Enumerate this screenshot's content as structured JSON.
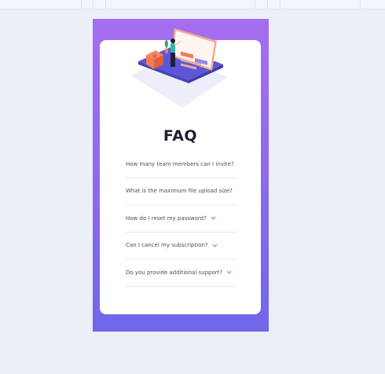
{
  "page": {
    "title": "FAQ"
  },
  "faq": {
    "items": [
      {
        "question": "How many team members can I invite?"
      },
      {
        "question": "What is the maximum file upload size?"
      },
      {
        "question": "How do I reset my password?"
      },
      {
        "question": "Can I cancel my subscription?"
      },
      {
        "question": "Do you provide additional support?"
      }
    ]
  },
  "colors": {
    "gradient_top": "#a66ef0",
    "gradient_bottom": "#6f67e9",
    "card_background": "#ffffff",
    "title_color": "#1e1f36",
    "question_color": "#4a4b5e",
    "chevron_color": "#f47b56",
    "divider_color": "#e8e8ee"
  },
  "icons": {
    "chevron": "chevron-down-icon",
    "illustration": "woman-with-online-board-illustration"
  }
}
